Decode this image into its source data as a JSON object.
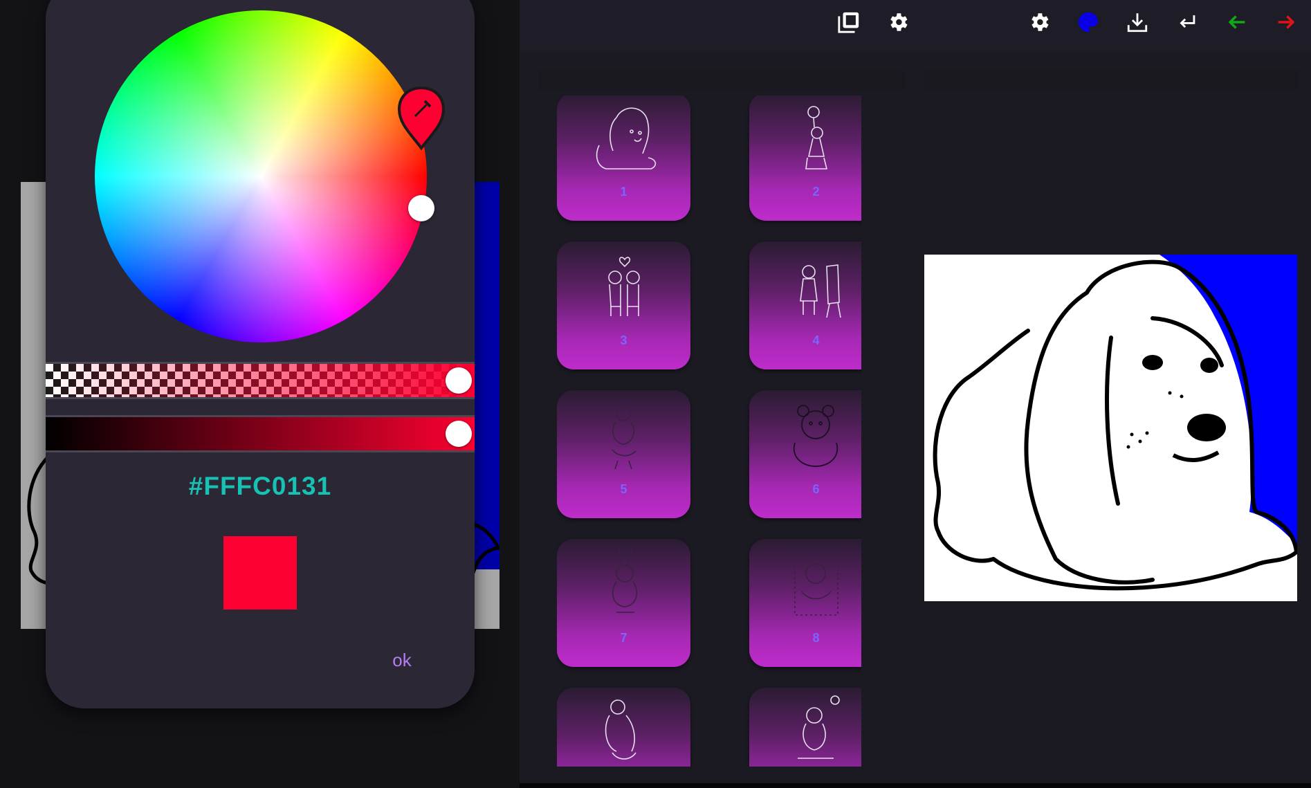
{
  "picker": {
    "hex_value": "#FFFC0131",
    "selected_color": "#FC0131",
    "alpha": 1.0,
    "brightness": 1.0,
    "ok_label": "ok",
    "hex_text_color": "#17C2B4"
  },
  "toolbar": {
    "buttons": [
      {
        "name": "gallery-icon"
      },
      {
        "name": "settings-icon"
      },
      {
        "name": "settings-icon"
      },
      {
        "name": "palette-icon",
        "color": "#0A00E6"
      },
      {
        "name": "download-icon"
      },
      {
        "name": "return-icon"
      },
      {
        "name": "undo-arrow-icon",
        "color": "#13A81A"
      },
      {
        "name": "redo-arrow-icon",
        "color": "#E01414"
      }
    ]
  },
  "gallery": {
    "items": [
      {
        "label": "1"
      },
      {
        "label": "2"
      },
      {
        "label": "3"
      },
      {
        "label": "4"
      },
      {
        "label": "5"
      },
      {
        "label": "6"
      },
      {
        "label": "7"
      },
      {
        "label": "8"
      },
      {
        "label": ""
      },
      {
        "label": ""
      }
    ]
  },
  "preview": {
    "background_fill": "#0000FF",
    "subject": "puppy"
  },
  "colors": {
    "dialog_bg": "#2B2735",
    "app_bg": "#1B1A22",
    "thumb_gradient_end": "#BE2CCB",
    "thumb_number": "#7B64FF",
    "ok_text": "#B37DF0"
  }
}
